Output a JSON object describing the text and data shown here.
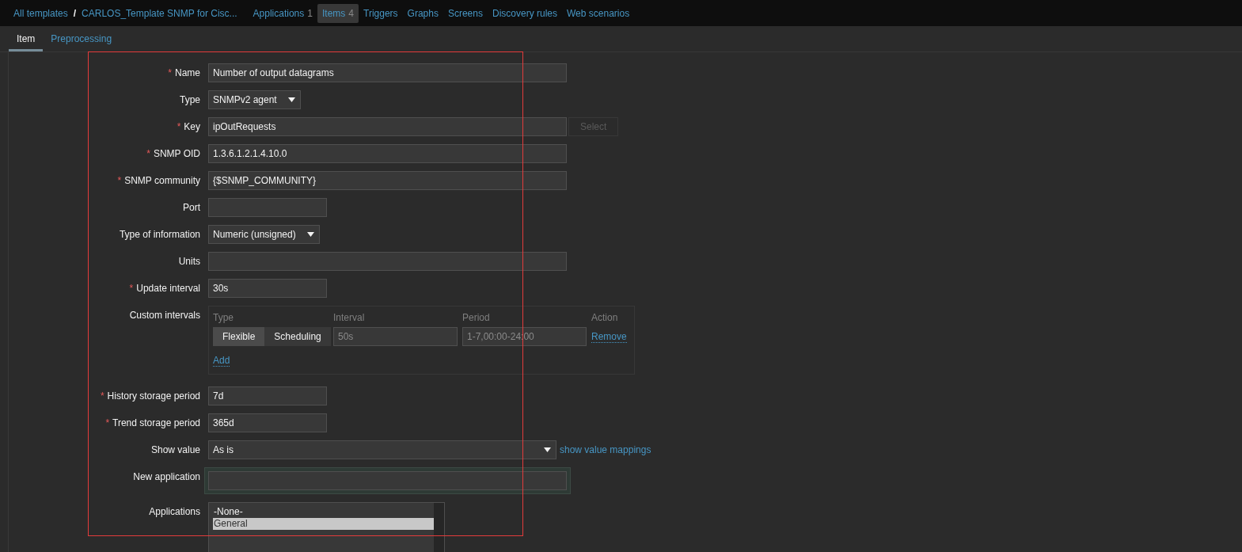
{
  "nav": {
    "breadcrumbs": [
      {
        "label": "All templates"
      },
      {
        "label": "CARLOS_Template SNMP for Cisc..."
      }
    ],
    "separator": "/",
    "links": [
      {
        "label": "Applications",
        "count": "1",
        "selected": false
      },
      {
        "label": "Items",
        "count": "4",
        "selected": true
      },
      {
        "label": "Triggers",
        "selected": false
      },
      {
        "label": "Graphs",
        "selected": false
      },
      {
        "label": "Screens",
        "selected": false
      },
      {
        "label": "Discovery rules",
        "selected": false
      },
      {
        "label": "Web scenarios",
        "selected": false
      }
    ]
  },
  "tabs": [
    {
      "label": "Item",
      "selected": true
    },
    {
      "label": "Preprocessing",
      "selected": false
    }
  ],
  "form": {
    "fields": [
      {
        "kind": "input",
        "label": "Name",
        "marker": "*",
        "value": "Number of output datagrams",
        "wide": true
      },
      {
        "kind": "select",
        "label": "Type",
        "value": "SNMPv2 agent",
        "wide": false
      },
      {
        "kind": "input",
        "label": "Key",
        "marker": "*",
        "value": "ipOutRequests",
        "wide": true,
        "button": {
          "label": "Select",
          "disabled": true
        }
      },
      {
        "kind": "input",
        "label": "SNMP OID",
        "marker": "*",
        "value": "1.3.6.1.2.1.4.10.0",
        "wide": true
      },
      {
        "kind": "input",
        "label": "SNMP community",
        "marker": "*",
        "value": "{$SNMP_COMMUNITY}",
        "wide": true
      },
      {
        "kind": "input",
        "label": "Port",
        "wide": false
      },
      {
        "kind": "select",
        "label": "Type of information",
        "value": "Numeric (unsigned)",
        "wide": false
      },
      {
        "kind": "input",
        "label": "Units",
        "wide": true
      },
      {
        "kind": "input",
        "label": "Update interval",
        "marker": "*",
        "value": "30s",
        "wide": false
      },
      {
        "kind": "intervals",
        "label": "Custom intervals",
        "columns": [
          "Type",
          "Interval",
          "Period",
          "Action"
        ],
        "rows": [
          {
            "modes": [
              {
                "label": "Flexible",
                "selected": true
              },
              {
                "label": "Scheduling",
                "selected": false
              }
            ],
            "interval_placeholder": "50s",
            "period_placeholder": "1-7,00:00-24:00",
            "action": "Remove"
          }
        ],
        "add": "Add"
      },
      {
        "kind": "input",
        "label": "History storage period",
        "marker": "*",
        "value": "7d",
        "wide": false
      },
      {
        "kind": "input",
        "label": "Trend storage period",
        "marker": "*",
        "value": "365d",
        "wide": false
      },
      {
        "kind": "select",
        "label": "Show value",
        "value": "As is",
        "wide": true,
        "link": "show value mappings"
      },
      {
        "kind": "input",
        "label": "New application",
        "wide": true,
        "focused": true
      },
      {
        "kind": "listbox",
        "label": "Applications",
        "options": [
          {
            "label": "-None-",
            "selected": false
          },
          {
            "label": "General",
            "selected": true
          }
        ]
      }
    ]
  }
}
